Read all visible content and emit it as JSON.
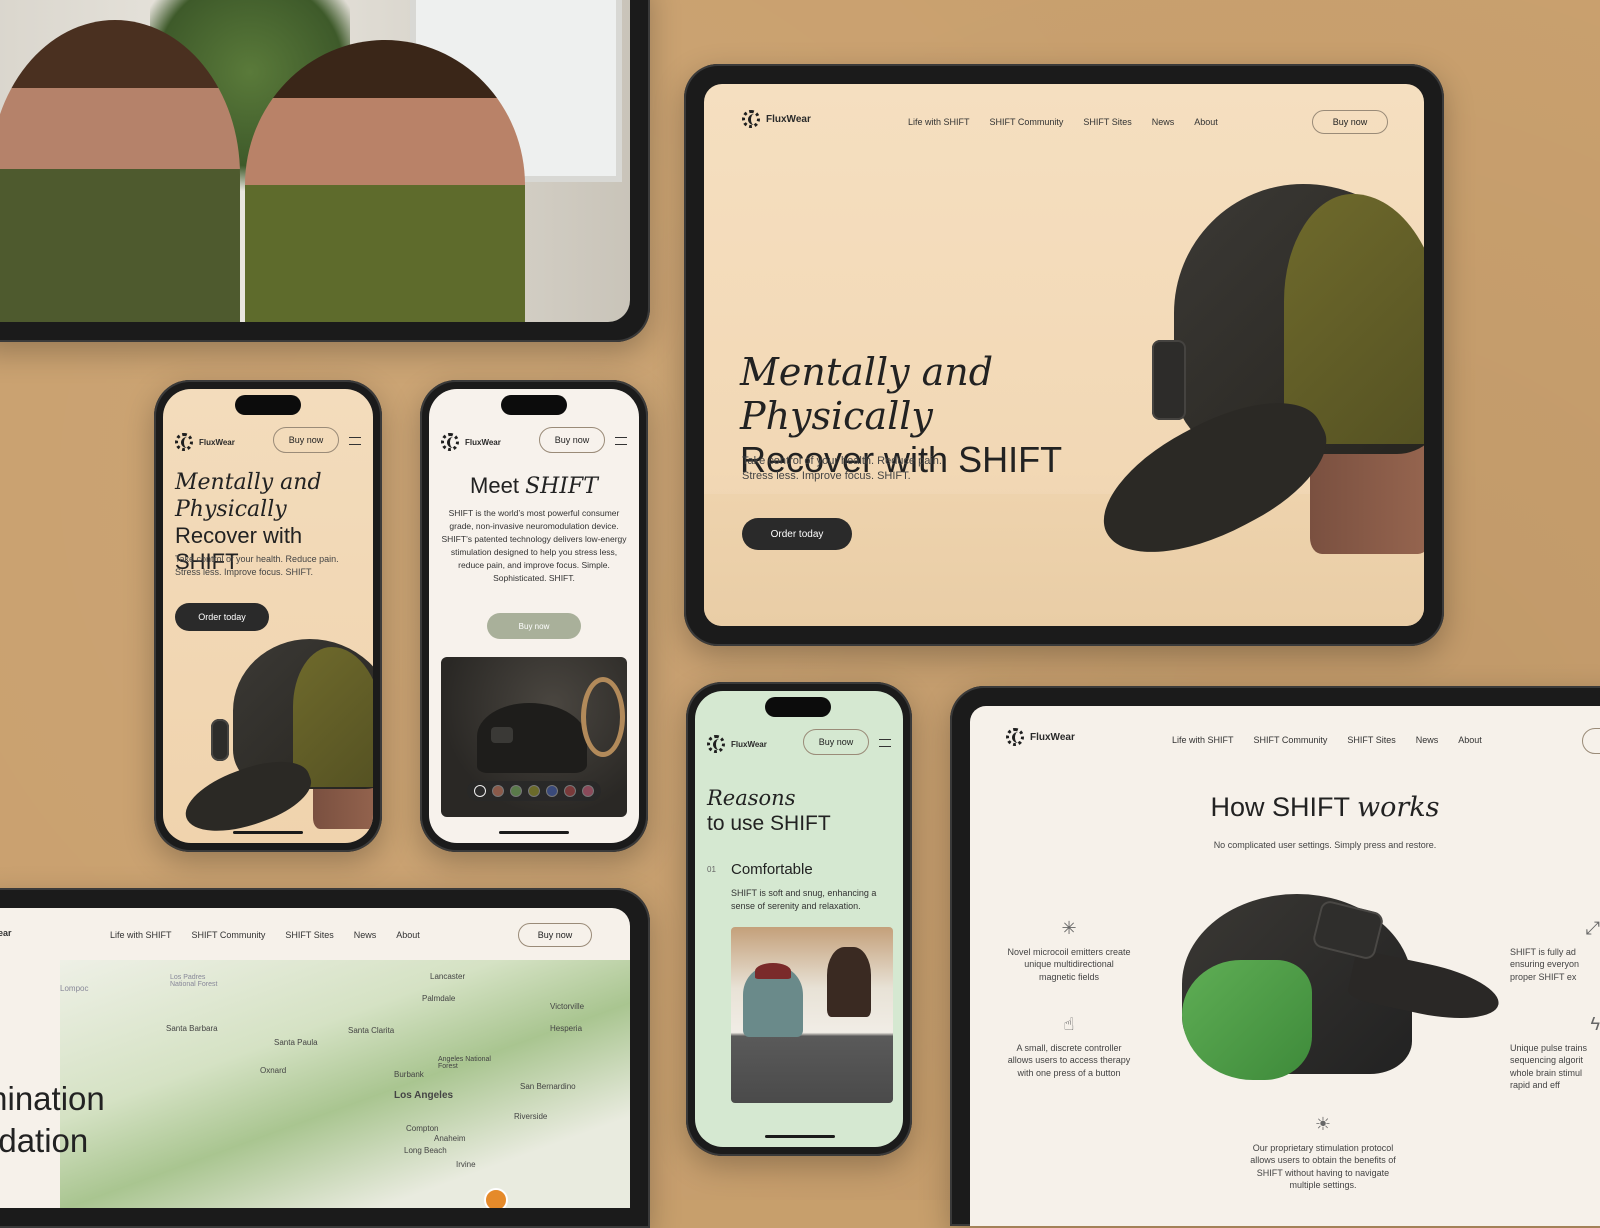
{
  "brand": {
    "name": "FluxWear"
  },
  "nav": {
    "items": [
      "Life with SHIFT",
      "SHIFT Community",
      "SHIFT Sites",
      "News",
      "About"
    ],
    "buy_now": "Buy now"
  },
  "hero": {
    "title_italic": "Mentally and Physically",
    "title_plain": "Recover with SHIFT",
    "title_mobile_italic": "Mentally and Physically",
    "title_mobile_plain1": "Recover",
    "title_mobile_plain2": "with SHIFT",
    "subtitle": "Take control of your health. Reduce pain. Stress less. Improve focus. SHIFT.",
    "cta": "Order today"
  },
  "meet": {
    "title_plain": "Meet",
    "title_italic": "SHIFT",
    "body": "SHIFT is the world’s most powerful consumer grade, non-invasive neuromodulation device. SHIFT’s patented technology delivers low-energy stimulation designed to help you stress less, reduce pain, and improve focus. Simple. Sophisticated. SHIFT.",
    "cta": "Buy now",
    "swatch_colors": [
      "#2b2b2b",
      "#8a5a4a",
      "#5a7a4a",
      "#6b6a2a",
      "#3a4a7a",
      "#7a3a3a",
      "#8a4a5a"
    ]
  },
  "reasons": {
    "title_italic": "Reasons",
    "title_plain": "to use SHIFT",
    "item_number": "01",
    "item_title": "Comfortable",
    "item_body": "SHIFT is soft and snug, enhancing a sense of serenity and relaxation."
  },
  "how": {
    "title_plain": "How SHIFT",
    "title_italic": "works",
    "subtitle": "No complicated user settings. Simply press and restore.",
    "features": [
      {
        "icon": "emitter-icon",
        "text": "Novel microcoil emitters create unique multidirectional magnetic fields"
      },
      {
        "icon": "tap-icon",
        "text": "A small, discrete controller allows users to access therapy with one press of a button"
      },
      {
        "icon": "bulb-icon",
        "text": "Our proprietary stimulation protocol allows users to obtain the benefits of SHIFT without having to navigate multiple settings."
      },
      {
        "icon": "expand-icon",
        "text": "SHIFT is fully ad ensuring everyon proper SHIFT ex"
      },
      {
        "icon": "bolt-icon",
        "text": "Unique pulse trains sequencing algorit whole brain stimul rapid and eff"
      }
    ]
  },
  "map_section": {
    "partial_logo": "ear",
    "heading_line1": "mination",
    "heading_line2": "ndation",
    "labels": [
      "Lancaster",
      "Los Padres National Forest",
      "Lompoc",
      "Palmdale",
      "Victorville",
      "Santa Barbara",
      "Santa Clarita",
      "Hesperia",
      "Santa Paula",
      "Oxnard",
      "Angeles National Forest",
      "Burbank",
      "San Bernardino",
      "Los Angeles",
      "Riverside",
      "Compton",
      "Anaheim",
      "Long Beach",
      "Irvine"
    ]
  },
  "colors": {
    "background": "#c9a06e",
    "hero_bg": "#f3dcbc",
    "reasons_bg": "#d7e8d2",
    "how_bg": "#f6f1ea",
    "accent_dark": "#2a2a2a",
    "meet_cta": "#a9b09a"
  }
}
